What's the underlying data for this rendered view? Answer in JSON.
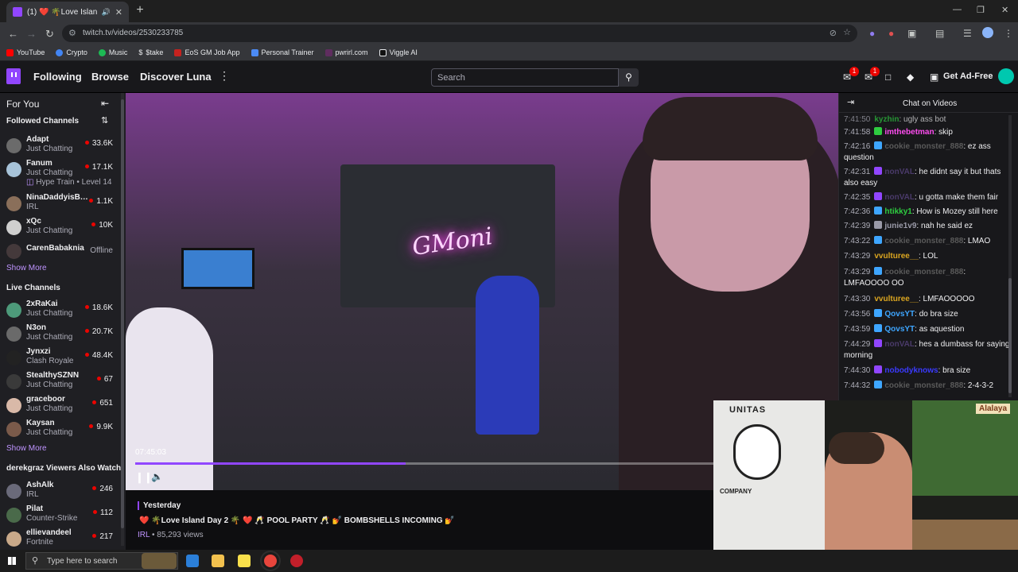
{
  "browser": {
    "tab_title": "(1) ❤️ 🌴Love Island Day 2 🌴",
    "url": "twitch.tv/videos/2530233785",
    "bookmarks": [
      {
        "label": "YouTube",
        "color": "#ff0000"
      },
      {
        "label": "Crypto",
        "color": "#4285f4"
      },
      {
        "label": "Music",
        "color": "#1db954"
      },
      {
        "label": "$take",
        "color": "#e8eaed"
      },
      {
        "label": "EoS GM Job App",
        "color": "#c5221f"
      },
      {
        "label": "Personal Trainer",
        "color": "#4c8bf5"
      },
      {
        "label": "pwrirl.com",
        "color": "#5f2d5f"
      },
      {
        "label": "Viggle AI",
        "color": "#e8eaed"
      }
    ]
  },
  "topnav": {
    "following": "Following",
    "browse": "Browse",
    "discover": "Discover Luna",
    "search_placeholder": "Search",
    "get_ad_free": "Get Ad-Free",
    "notif_count_1": "1",
    "notif_count_2": "1"
  },
  "sidebar": {
    "for_you": "For You",
    "followed_header": "Followed Channels",
    "followed": [
      {
        "name": "Adapt",
        "category": "Just Chatting",
        "viewers": "33.6K",
        "color": "#6b6b6b"
      },
      {
        "name": "Fanum",
        "category": "Just Chatting",
        "viewers": "17.1K",
        "extra": "Hype Train • Level 14",
        "color": "#a7c3d9"
      },
      {
        "name": "NinaDaddyisBa...",
        "category": "IRL",
        "viewers": "1.1K",
        "color": "#8a6f5a"
      },
      {
        "name": "xQc",
        "category": "Just Chatting",
        "viewers": "10K",
        "color": "#cfcfcf"
      },
      {
        "name": "CarenBabaknia",
        "category": "",
        "offline": "Offline",
        "color": "#5e4b4b"
      }
    ],
    "show_more_1": "Show More",
    "live_header": "Live Channels",
    "live": [
      {
        "name": "2xRaKai",
        "category": "Just Chatting",
        "viewers": "18.6K",
        "color": "#4d9a7a"
      },
      {
        "name": "N3on",
        "category": "Just Chatting",
        "viewers": "20.7K",
        "color": "#6a6a6a"
      },
      {
        "name": "Jynxzi",
        "category": "Clash Royale",
        "viewers": "48.4K",
        "color": "#222222"
      },
      {
        "name": "StealthySZNN",
        "category": "Just Chatting",
        "viewers": "67",
        "color": "#3a3a3a"
      },
      {
        "name": "graceboor",
        "category": "Just Chatting",
        "viewers": "651",
        "color": "#d9b9a8"
      },
      {
        "name": "Kaysan",
        "category": "Just Chatting",
        "viewers": "9.9K",
        "color": "#7a5a4a"
      }
    ],
    "show_more_2": "Show More",
    "also_watch_header": "derekgraz Viewers Also Watch",
    "also_watch": [
      {
        "name": "AshAlk",
        "category": "IRL",
        "viewers": "246",
        "color": "#6a6a7a"
      },
      {
        "name": "Pilat",
        "category": "Counter-Strike",
        "viewers": "112",
        "color": "#4a6a4a"
      },
      {
        "name": "ellievandeel",
        "category": "Fortnite",
        "viewers": "217",
        "color": "#c9a98a"
      }
    ]
  },
  "video": {
    "timestamp": "07:45:03",
    "progress": 0.46,
    "neon_sign": "GMoni",
    "when": "Yesterday",
    "title": "❤️ 🌴Love Island Day 2 🌴 ❤️ 🥂 POOL PARTY 🥂 💅 BOMBSHELLS INCOMING 💅",
    "category": "IRL",
    "views": " • 85,293 views"
  },
  "facecam": {
    "banner_top": "UNITAS",
    "banner_mid": "COMPANY",
    "sign": "Alalaya"
  },
  "chat": {
    "title": "Chat on Videos",
    "messages": [
      {
        "ts": "7:41:58",
        "user": "imthebetman",
        "color": "#ff4df0",
        "text": ": skip",
        "badge": "#2ecc40"
      },
      {
        "ts": "7:42:16",
        "user": "cookie_monster_888",
        "color": "#5a5a5a",
        "text": ": ez ass question",
        "badge": "#3ea6ff"
      },
      {
        "ts": "7:42:31",
        "user": "nonVAL",
        "color": "#4a3a6a",
        "text": ": he didnt say it but thats also easy",
        "badge": "#9146ff"
      },
      {
        "ts": "7:42:35",
        "user": "nonVAL",
        "color": "#4a3a6a",
        "text": ": u gotta make them fair",
        "badge": "#9146ff"
      },
      {
        "ts": "7:42:36",
        "user": "htikky1",
        "color": "#2ecc40",
        "text": ": How is Mozey still here",
        "badge": "#3ea6ff"
      },
      {
        "ts": "7:42:39",
        "user": "junie1v9",
        "color": "#9a9aa8",
        "text": ": nah he said ez",
        "badge": "#9a9aa8"
      },
      {
        "ts": "7:43:22",
        "user": "cookie_monster_888",
        "color": "#5a5a5a",
        "text": ": LMAO",
        "badge": "#3ea6ff"
      },
      {
        "ts": "7:43:29",
        "user": "vvulturee__",
        "color": "#daa520",
        "text": ": LOL",
        "badge": ""
      },
      {
        "ts": "7:43:29",
        "user": "cookie_monster_888",
        "color": "#5a5a5a",
        "text": ": LMFAOOOO OO",
        "badge": "#3ea6ff"
      },
      {
        "ts": "7:43:30",
        "user": "vvulturee__",
        "color": "#daa520",
        "text": ": LMFAOOOOO",
        "badge": ""
      },
      {
        "ts": "7:43:56",
        "user": "QovsYT",
        "color": "#3ea6ff",
        "text": ": do bra size",
        "badge": "#3ea6ff"
      },
      {
        "ts": "7:43:59",
        "user": "QovsYT",
        "color": "#3ea6ff",
        "text": ": as aquestion",
        "badge": "#3ea6ff"
      },
      {
        "ts": "7:44:29",
        "user": "nonVAL",
        "color": "#4a3a6a",
        "text": ": hes a dumbass for saying morning",
        "badge": "#9146ff"
      },
      {
        "ts": "7:44:30",
        "user": "nobodyknows",
        "color": "#3a3aff",
        "text": ": bra size",
        "badge": "#9146ff"
      },
      {
        "ts": "7:44:32",
        "user": "cookie_monster_888",
        "color": "#5a5a5a",
        "text": ": 2-4-3-2",
        "badge": "#3ea6ff"
      }
    ]
  },
  "taskbar": {
    "search_placeholder": "Type here to search"
  }
}
